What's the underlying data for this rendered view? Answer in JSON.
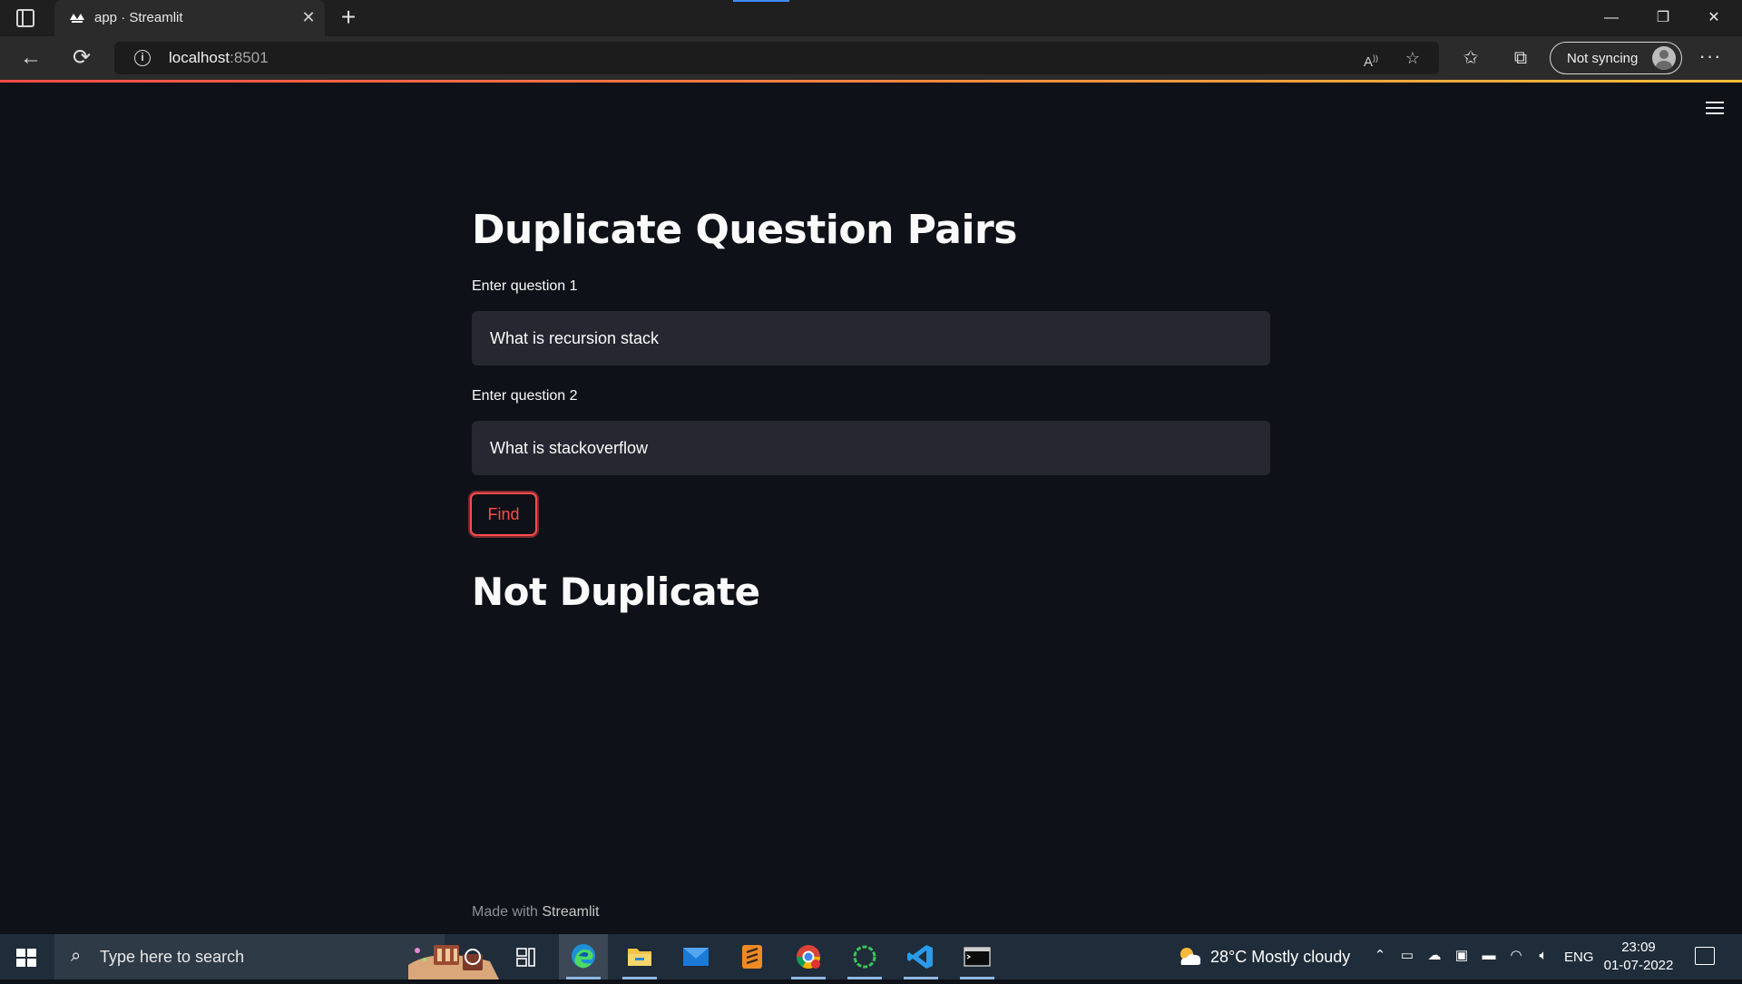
{
  "browser": {
    "tab_title": "app · Streamlit",
    "url_host": "localhost",
    "url_port": ":8501",
    "sync_label": "Not syncing",
    "gradient_colors": [
      "#ff4b4b",
      "#fdbf3a"
    ]
  },
  "app": {
    "title": "Duplicate Question Pairs",
    "question1_label": "Enter question 1",
    "question1_value": "What is recursion stack",
    "question2_label": "Enter question 2",
    "question2_value": "What is stackoverflow",
    "find_label": "Find",
    "result": "Not Duplicate",
    "footer_prefix": "Made with ",
    "footer_brand": "Streamlit",
    "accent_color": "#ff4b4b",
    "background_color": "#0e1117"
  },
  "taskbar": {
    "search_placeholder": "Type here to search",
    "weather": "28°C  Mostly cloudy",
    "language": "ENG",
    "time": "23:09",
    "date": "01-07-2022",
    "pinned_apps": [
      "cortana",
      "task-view",
      "edge",
      "file-explorer",
      "mail",
      "sublime-text",
      "chrome",
      "spinner-app",
      "vscode",
      "terminal"
    ]
  }
}
